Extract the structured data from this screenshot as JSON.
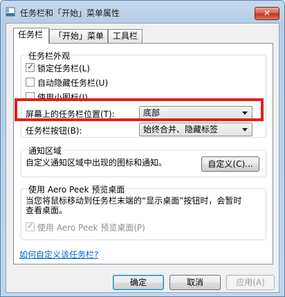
{
  "window": {
    "title": "任务栏和「开始」菜单属性",
    "close_label": "✕"
  },
  "tabs": [
    {
      "label": "任务栏"
    },
    {
      "label": "「开始」菜单"
    },
    {
      "label": "工具栏"
    }
  ],
  "appearance": {
    "title": "任务栏外观",
    "lock_label": "锁定任务栏(L)",
    "lock_checked": true,
    "autohide_label": "自动隐藏任务栏(U)",
    "autohide_checked": false,
    "small_icons_label": "使用小图标(I)",
    "small_icons_checked": false,
    "position_label": "屏幕上的任务栏位置(T):",
    "position_value": "底部",
    "buttons_label": "任务栏按钮(B):",
    "buttons_value": "始终合并、隐藏标签"
  },
  "notification": {
    "title": "通知区域",
    "desc": "自定义通知区域中出现的图标和通知。",
    "customize_label": "自定义(C)..."
  },
  "aero": {
    "title": "使用 Aero Peek 预览桌面",
    "desc_line1": "当您将鼠标移动到任务栏末端的“显示桌面”按钮时，会暂时",
    "desc_line2": "查看桌面。",
    "checkbox_label": "使用 Aero Peek 预览桌面(P)",
    "checkbox_checked": true
  },
  "link": {
    "label": "如何自定义该任务栏?"
  },
  "footer": {
    "ok_label": "确定",
    "cancel_label": "取消",
    "apply_label": "应用(A)"
  },
  "colors": {
    "highlight": "#e0201c",
    "link": "#0066cc"
  }
}
